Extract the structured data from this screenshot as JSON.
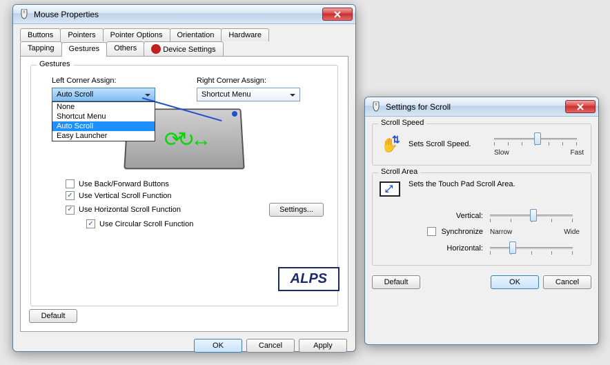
{
  "mainWindow": {
    "title": "Mouse Properties",
    "tabs_row1": [
      "Buttons",
      "Pointers",
      "Pointer Options",
      "Orientation",
      "Hardware"
    ],
    "tabs_row2": [
      "Tapping",
      "Gestures",
      "Others",
      "Device Settings"
    ],
    "activeTab": "Gestures",
    "group": "Gestures",
    "left_label": "Left Corner Assign:",
    "right_label": "Right Corner Assign:",
    "left_value": "Auto Scroll",
    "right_value": "Shortcut Menu",
    "left_options": [
      "None",
      "Shortcut Menu",
      "Auto Scroll",
      "Easy Launcher"
    ],
    "left_selected_index": 2,
    "checks": {
      "back_forward": {
        "label": "Use Back/Forward Buttons",
        "checked": false
      },
      "vert": {
        "label": "Use Vertical Scroll Function",
        "checked": true
      },
      "horiz": {
        "label": "Use Horizontal Scroll Function",
        "checked": true
      },
      "circ": {
        "label": "Use Circular Scroll Function",
        "checked": true
      }
    },
    "settings_btn": "Settings...",
    "default_btn": "Default",
    "brand": "ALPS",
    "ok": "OK",
    "cancel": "Cancel",
    "apply": "Apply"
  },
  "scrollWindow": {
    "title": "Settings for Scroll",
    "group_speed": "Scroll Speed",
    "speed_desc": "Sets Scroll Speed.",
    "slow": "Slow",
    "fast": "Fast",
    "group_area": "Scroll Area",
    "area_desc": "Sets the Touch Pad Scroll Area.",
    "vertical": "Vertical:",
    "horizontal": "Horizontal:",
    "sync": "Synchronize",
    "narrow": "Narrow",
    "wide": "Wide",
    "default": "Default",
    "ok": "OK",
    "cancel": "Cancel"
  }
}
